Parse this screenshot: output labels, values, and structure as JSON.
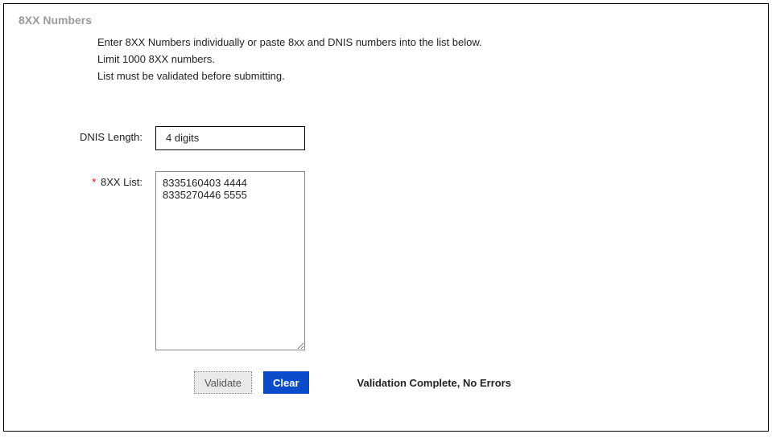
{
  "panel": {
    "title": "8XX Numbers",
    "instructions": [
      "Enter 8XX Numbers individually or paste 8xx and DNIS numbers into the list below.",
      "Limit 1000 8XX numbers.",
      "List must be validated before submitting."
    ]
  },
  "form": {
    "dnis_length": {
      "label": "DNIS Length:",
      "value": "4 digits"
    },
    "list_8xx": {
      "label": "8XX List:",
      "required_marker": "*",
      "value": "8335160403 4444\n8335270446 5555"
    }
  },
  "buttons": {
    "validate": "Validate",
    "clear": "Clear"
  },
  "status": {
    "message": "Validation Complete, No Errors"
  }
}
